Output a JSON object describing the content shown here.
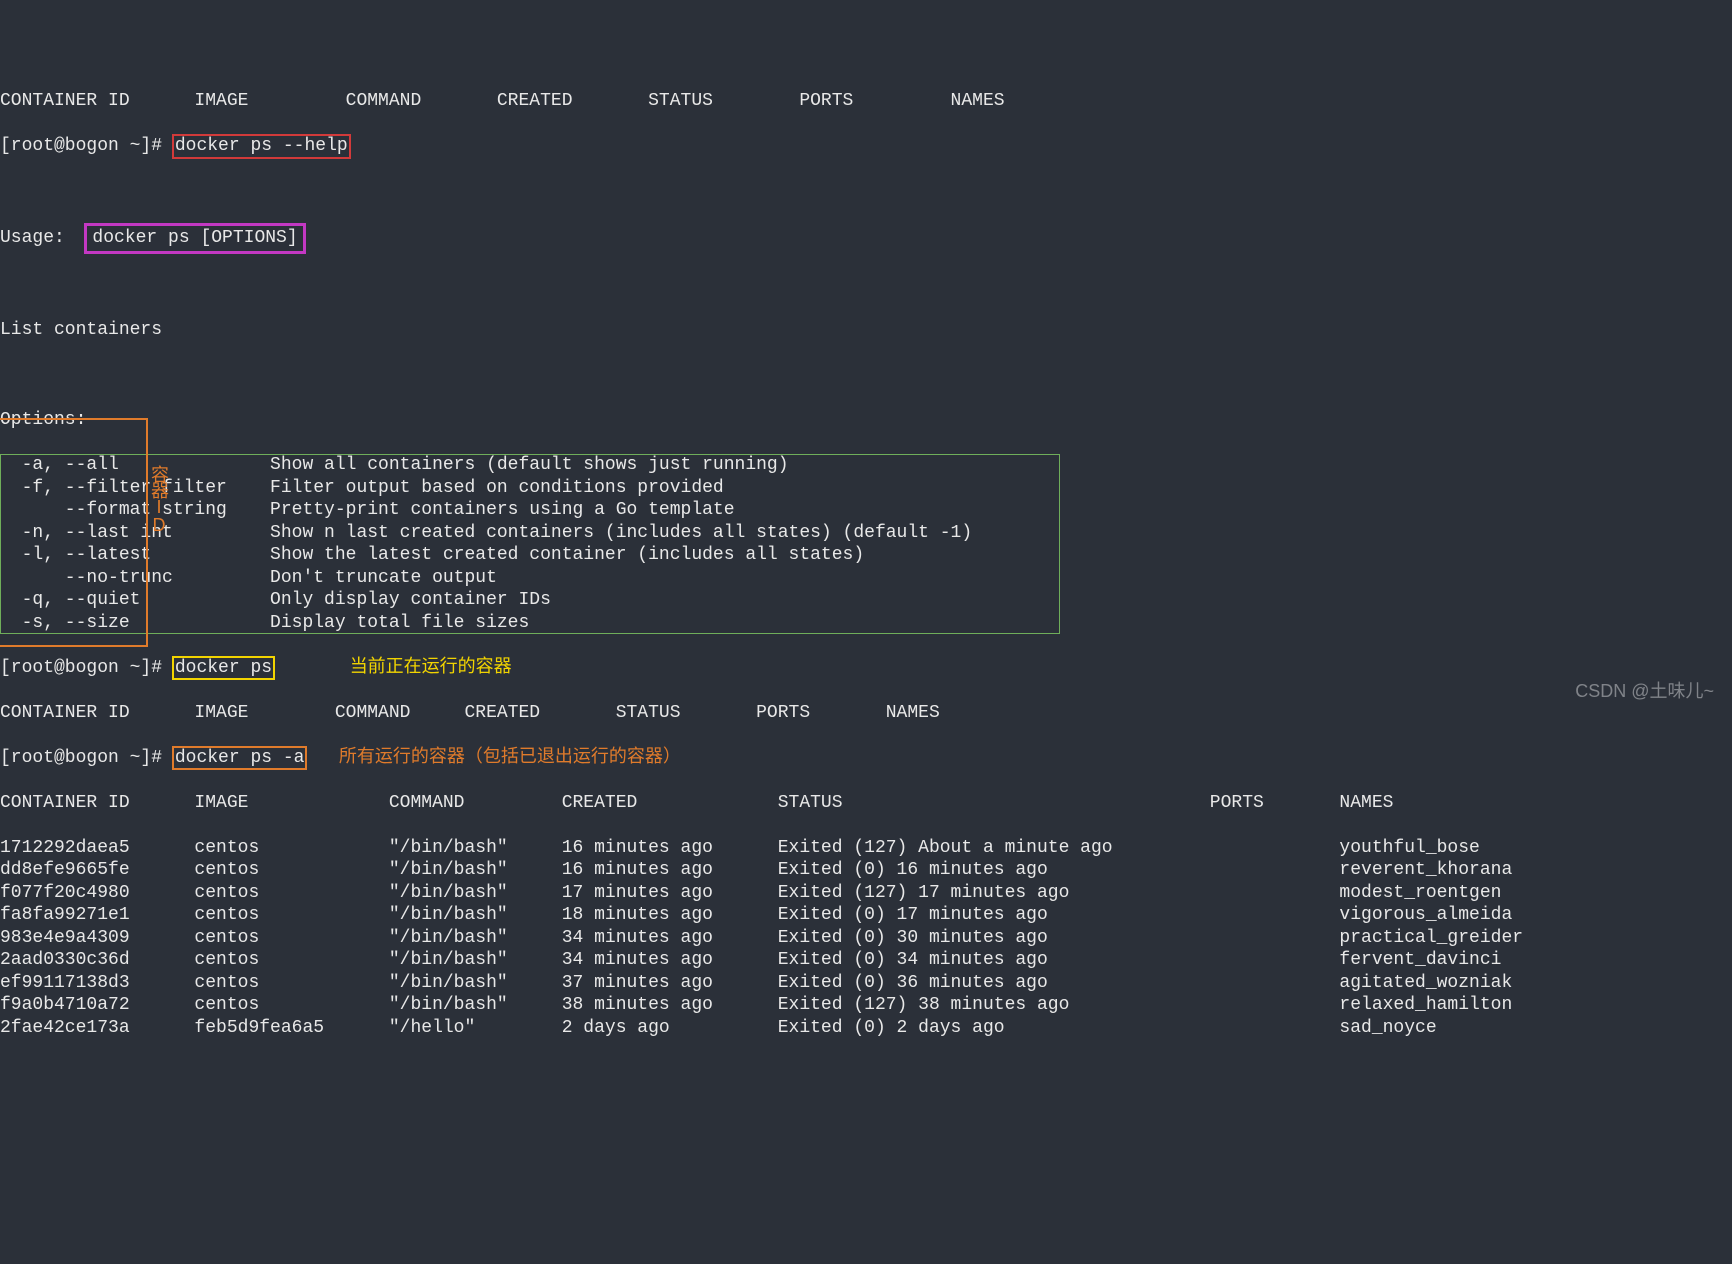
{
  "header_cut": "CONTAINER ID      IMAGE         COMMAND       CREATED       STATUS        PORTS         NAMES",
  "prompt": "[root@bogon ~]#",
  "cmd_help": "docker ps --help",
  "usage_label": "Usage:",
  "usage_text": "docker ps [OPTIONS]",
  "list_containers": "List containers",
  "options_label": "Options:",
  "options": [
    {
      "flag": "-a, --all",
      "desc": "Show all containers (default shows just running)"
    },
    {
      "flag": "-f, --filter filter",
      "desc": "Filter output based on conditions provided"
    },
    {
      "flag": "    --format string",
      "desc": "Pretty-print containers using a Go template"
    },
    {
      "flag": "-n, --last int",
      "desc": "Show n last created containers (includes all states) (default -1)"
    },
    {
      "flag": "-l, --latest",
      "desc": "Show the latest created container (includes all states)"
    },
    {
      "flag": "    --no-trunc",
      "desc": "Don't truncate output"
    },
    {
      "flag": "-q, --quiet",
      "desc": "Only display container IDs"
    },
    {
      "flag": "-s, --size",
      "desc": "Display total file sizes"
    }
  ],
  "cmd_ps": "docker ps",
  "note_ps": "当前正在运行的容器",
  "ps_header": "CONTAINER ID      IMAGE        COMMAND     CREATED       STATUS       PORTS       NAMES",
  "cmd_ps_a": "docker ps -a",
  "note_ps_a": "所有运行的容器（包括已退出运行的容器）",
  "psa_header_cols": [
    "CONTAINER ID",
    "IMAGE",
    "COMMAND",
    "CREATED",
    "STATUS",
    "PORTS",
    "NAMES"
  ],
  "id_side_label": "容器ID",
  "rows": [
    {
      "id": "1712292daea5",
      "image": "centos",
      "cmd": "\"/bin/bash\"",
      "created": "16 minutes ago",
      "status": "Exited (127) About a minute ago",
      "ports": "",
      "names": "youthful_bose"
    },
    {
      "id": "dd8efe9665fe",
      "image": "centos",
      "cmd": "\"/bin/bash\"",
      "created": "16 minutes ago",
      "status": "Exited (0) 16 minutes ago",
      "ports": "",
      "names": "reverent_khorana"
    },
    {
      "id": "f077f20c4980",
      "image": "centos",
      "cmd": "\"/bin/bash\"",
      "created": "17 minutes ago",
      "status": "Exited (127) 17 minutes ago",
      "ports": "",
      "names": "modest_roentgen"
    },
    {
      "id": "fa8fa99271e1",
      "image": "centos",
      "cmd": "\"/bin/bash\"",
      "created": "18 minutes ago",
      "status": "Exited (0) 17 minutes ago",
      "ports": "",
      "names": "vigorous_almeida"
    },
    {
      "id": "983e4e9a4309",
      "image": "centos",
      "cmd": "\"/bin/bash\"",
      "created": "34 minutes ago",
      "status": "Exited (0) 30 minutes ago",
      "ports": "",
      "names": "practical_greider"
    },
    {
      "id": "2aad0330c36d",
      "image": "centos",
      "cmd": "\"/bin/bash\"",
      "created": "34 minutes ago",
      "status": "Exited (0) 34 minutes ago",
      "ports": "",
      "names": "fervent_davinci"
    },
    {
      "id": "ef99117138d3",
      "image": "centos",
      "cmd": "\"/bin/bash\"",
      "created": "37 minutes ago",
      "status": "Exited (0) 36 minutes ago",
      "ports": "",
      "names": "agitated_wozniak"
    },
    {
      "id": "f9a0b4710a72",
      "image": "centos",
      "cmd": "\"/bin/bash\"",
      "created": "38 minutes ago",
      "status": "Exited (127) 38 minutes ago",
      "ports": "",
      "names": "relaxed_hamilton"
    },
    {
      "id": "2fae42ce173a",
      "image": "feb5d9fea6a5",
      "cmd": "\"/hello\"",
      "created": "2 days ago",
      "status": "Exited (0) 2 days ago",
      "ports": "",
      "names": "sad_noyce"
    }
  ],
  "watermark": "CSDN @土味儿~"
}
